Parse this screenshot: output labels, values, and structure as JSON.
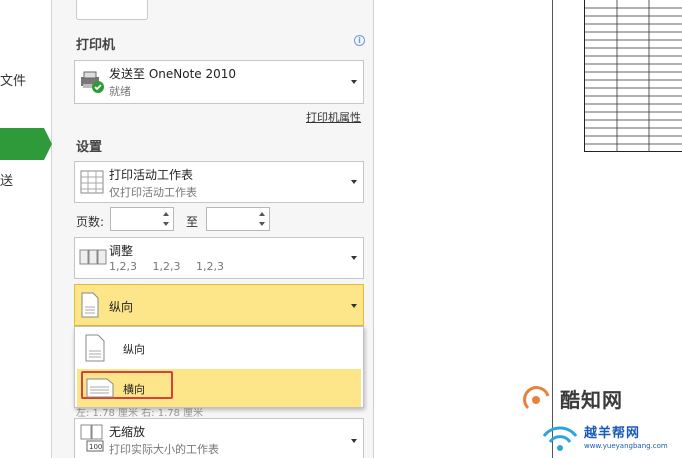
{
  "nav": {
    "item_file": "文件",
    "item_other": "送"
  },
  "printer": {
    "section_title": "打印机",
    "name": "发送至 OneNote 2010",
    "status": "就绪",
    "properties_link": "打印机属性"
  },
  "settings": {
    "section_title": "设置",
    "print_what": {
      "main": "打印活动工作表",
      "sub": "仅打印活动工作表"
    },
    "pages_label": "页数:",
    "to_label": "至",
    "pages_from": "",
    "pages_to": "",
    "collate": {
      "main": "调整",
      "sub": [
        "1,2,3",
        "1,2,3",
        "1,2,3"
      ]
    },
    "orientation": {
      "selected": "纵向",
      "options": [
        "纵向",
        "横向"
      ],
      "highlighted": "横向"
    },
    "margins_hidden_text": "左: 1.78 厘米    右: 1.78 厘米",
    "scaling": {
      "main": "无缩放",
      "sub": "打印实际大小的工作表",
      "badge": "100"
    }
  },
  "watermark": {
    "brand1": "酷知网",
    "brand2": "越羊帮网",
    "url": "www.yueyangbang.com"
  },
  "colors": {
    "accent_green": "#2e9a3a",
    "highlight_yellow": "#fde58a",
    "annotation_red": "#d8413a"
  }
}
